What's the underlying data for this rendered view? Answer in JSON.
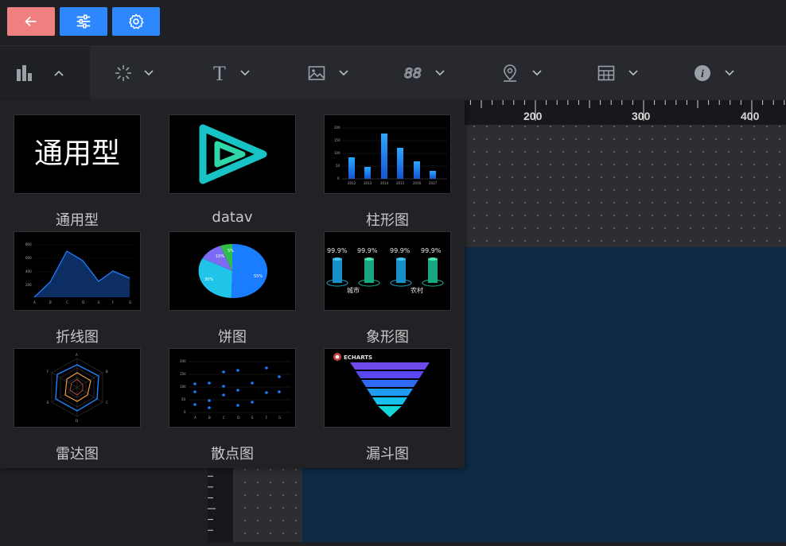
{
  "topbar": {
    "buttons": [
      {
        "name": "back-button",
        "icon": "arrow-left-icon",
        "color": "#f07f7f"
      },
      {
        "name": "filters-button",
        "icon": "sliders-icon",
        "color": "#2d88ff"
      },
      {
        "name": "settings-button",
        "icon": "gear-icon",
        "color": "#2d88ff"
      }
    ]
  },
  "toolbar": {
    "items": [
      {
        "name": "chart",
        "icon": "bar-chart-icon",
        "active": true
      },
      {
        "name": "decoration",
        "icon": "sparkle-icon"
      },
      {
        "name": "text",
        "icon": "text-icon"
      },
      {
        "name": "image",
        "icon": "image-icon"
      },
      {
        "name": "digital",
        "icon": "digits-icon"
      },
      {
        "name": "map",
        "icon": "map-pin-icon"
      },
      {
        "name": "table",
        "icon": "table-icon"
      },
      {
        "name": "info",
        "icon": "info-icon"
      }
    ]
  },
  "ruler": {
    "labels": [
      "200",
      "300",
      "400"
    ]
  },
  "panel": {
    "cards": [
      {
        "label": "通用型",
        "thumb_text": "通用型"
      },
      {
        "label": "datav"
      },
      {
        "label": "柱形图"
      },
      {
        "label": "折线图"
      },
      {
        "label": "饼图",
        "slices": [
          "55%",
          "30%",
          "10%",
          "5%"
        ]
      },
      {
        "label": "象形图",
        "values": [
          "99.9%",
          "99.9%",
          "99.9%",
          "99.9%"
        ],
        "categories": [
          "城市",
          "农村"
        ]
      },
      {
        "label": "雷达图"
      },
      {
        "label": "散点图"
      },
      {
        "label": "漏斗图",
        "brand": "ECHARTS"
      }
    ]
  },
  "colors": {
    "accent": "#2d88ff",
    "danger": "#f07f7f",
    "canvas": "#0e2a45"
  }
}
